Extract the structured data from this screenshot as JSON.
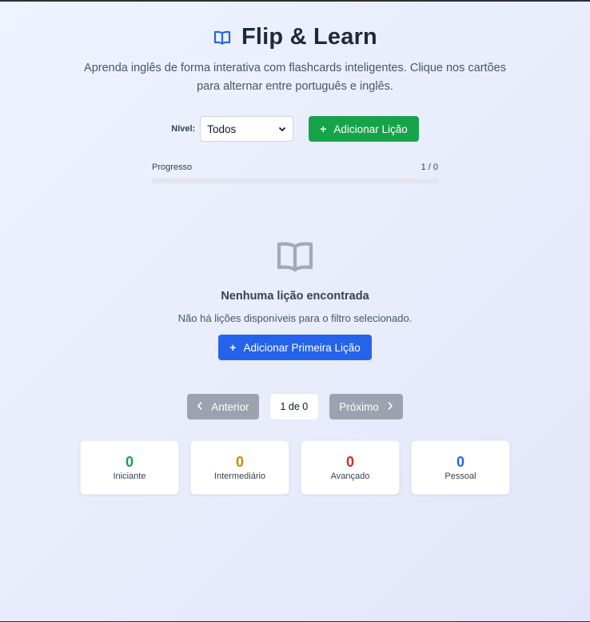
{
  "app": {
    "title": "Flip & Learn",
    "subtitle": "Aprenda inglês de forma interativa com flashcards inteligentes. Clique nos cartões para alternar entre português e inglês."
  },
  "controls": {
    "level_label": "Nível:",
    "level_selected": "Todos",
    "add_lesson_label": "Adicionar Lição"
  },
  "progress": {
    "label": "Progresso",
    "value_text": "1 / 0",
    "fraction": 0
  },
  "empty_state": {
    "title": "Nenhuma lição encontrada",
    "text": "Não há lições disponíveis para o filtro selecionado.",
    "button_label": "Adicionar Primeira Lição"
  },
  "pager": {
    "prev_label": "Anterior",
    "count_text": "1 de 0",
    "next_label": "Próximo"
  },
  "stats": [
    {
      "value": "0",
      "label": "Iniciante",
      "color": "#16a34a"
    },
    {
      "value": "0",
      "label": "Intermediário",
      "color": "#ca8a04"
    },
    {
      "value": "0",
      "label": "Avançado",
      "color": "#dc2626"
    },
    {
      "value": "0",
      "label": "Pessoal",
      "color": "#2563eb"
    }
  ],
  "icons": {
    "title": "open-book-icon",
    "empty": "open-book-icon",
    "plus": "plus-icon",
    "prev": "chevron-left-icon",
    "next": "chevron-right-icon",
    "select": "chevron-down-icon"
  },
  "colors": {
    "accent_blue": "#2563eb",
    "accent_green": "#16a34a",
    "disabled_gray": "#9ca3af"
  }
}
